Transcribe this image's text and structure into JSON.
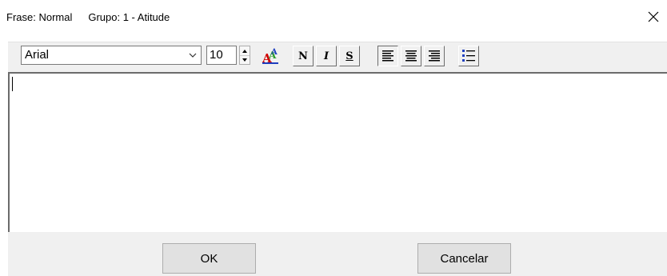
{
  "title_bar": {
    "frase_label": "Frase: Normal",
    "grupo_label": "Grupo: 1 - Atitude",
    "close_icon": "close-icon"
  },
  "toolbar": {
    "font_family_value": "Arial",
    "font_size_value": "10",
    "font_color_icon": "font-color-icon",
    "bold_label": "N",
    "italic_label": "I",
    "underline_label": "S",
    "align_left_icon": "align-left-icon",
    "align_center_icon": "align-center-icon",
    "align_right_icon": "align-right-icon",
    "bullet_list_icon": "bullet-list-icon"
  },
  "editor": {
    "content": ""
  },
  "footer": {
    "ok_label": "OK",
    "cancel_label": "Cancelar"
  },
  "colors": {
    "toolbar_bg": "#f0f0f0",
    "button_bg": "#e1e1e1",
    "icon_red": "#d00000",
    "icon_green": "#2e9e2e",
    "icon_blue": "#1f3fbf"
  }
}
